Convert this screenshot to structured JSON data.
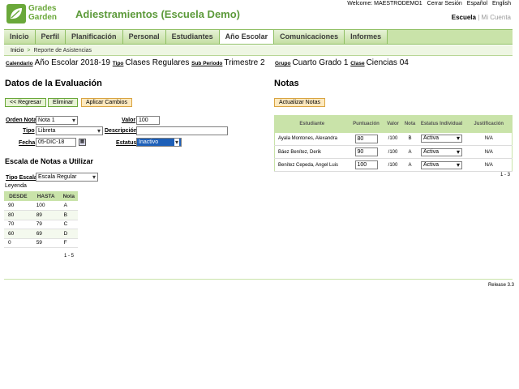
{
  "logo": {
    "line1": "Grades",
    "line2": "Garden"
  },
  "app_title": "Adiestramientos (Escuela Demo)",
  "top_links": {
    "welcome": "Welcome: MAESTRODEMO1",
    "logout": "Cerrar Sesión",
    "spanish": "Español",
    "english": "English"
  },
  "school_selector": {
    "school": "Escuela",
    "divider": "|",
    "account": "Mi Cuenta"
  },
  "nav": {
    "tabs": [
      "Inicio",
      "Perfil",
      "Planificación",
      "Personal",
      "Estudiantes",
      "Año Escolar",
      "Comunicaciones",
      "Informes"
    ],
    "active": "Año Escolar"
  },
  "breadcrumb": {
    "home": "Inicio",
    "sep": ">",
    "current": "Reporte de Asistencias"
  },
  "info": {
    "calendario_label": "Calendario",
    "calendario": "Año Escolar 2018-19",
    "tipo_label": "Tipo",
    "tipo": "Clases Regulares",
    "subperiodo_label": "Sub Periodo",
    "subperiodo": "Trimestre 2",
    "grupo_label": "Grupo",
    "grupo": "Cuarto Grado 1",
    "clase_label": "Clase",
    "clase": "Ciencias 04"
  },
  "evaluation": {
    "title": "Datos de la Evaluación",
    "buttons": {
      "back": "<< Regresar",
      "delete": "Eliminar",
      "apply": "Aplicar Cambios"
    },
    "orden_label": "Orden Nota",
    "orden_value": "Nota 1",
    "valor_label": "Valor",
    "valor_value": "100",
    "tipo_label": "Tipo",
    "tipo_value": "Libreta",
    "descripcion_label": "Descripción",
    "descripcion_value": "",
    "fecha_label": "Fecha",
    "fecha_value": "05-DIC-18",
    "estatus_label": "Estatus",
    "estatus_value": "Inactivo"
  },
  "scale": {
    "title": "Escala de Notas a Utilizar",
    "tipo_label": "Tipo Escala",
    "tipo_value": "Escala Regular",
    "legend_label": "Leyenda",
    "headers": [
      "DESDE",
      "HASTA",
      "Nota"
    ],
    "rows": [
      [
        "90",
        "100",
        "A"
      ],
      [
        "80",
        "89",
        "B"
      ],
      [
        "70",
        "79",
        "C"
      ],
      [
        "60",
        "69",
        "D"
      ],
      [
        "0",
        "59",
        "F"
      ]
    ],
    "pager": "1 - 5"
  },
  "notes": {
    "title": "Notas",
    "update_button": "Actualizar Notas",
    "headers": [
      "Estudiante",
      "Puntuación",
      "Valor",
      "Nota",
      "Estatus Individual",
      "Justificación"
    ],
    "rows": [
      {
        "student": "Ayala Montones, Alexandra",
        "score": "80",
        "value": "/100",
        "grade": "B",
        "status": "Activa",
        "justification": "N/A"
      },
      {
        "student": "Báez Benítez, Derik",
        "score": "90",
        "value": "/100",
        "grade": "A",
        "status": "Activa",
        "justification": "N/A"
      },
      {
        "student": "Benítez Cepeda, Angel Luis",
        "score": "100",
        "value": "/100",
        "grade": "A",
        "status": "Activa",
        "justification": "N/A"
      }
    ],
    "pager": "1 - 3"
  },
  "release": "Release 3.3"
}
